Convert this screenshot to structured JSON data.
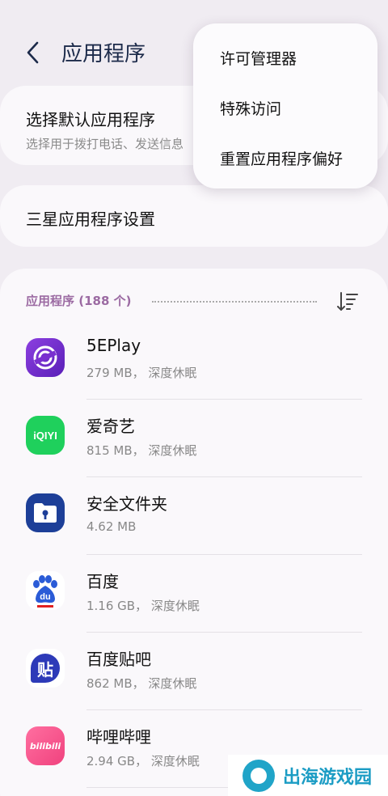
{
  "header": {
    "title": "应用程序"
  },
  "default_apps": {
    "title": "选择默认应用程序",
    "subtitle": "选择用于拨打电话、发送信息"
  },
  "samsung_settings": {
    "title": "三星应用程序设置"
  },
  "list": {
    "label": "应用程序 (188 个)",
    "apps": [
      {
        "name": "5EPlay",
        "meta": "279 MB， 深度休眠",
        "icon": "5eplay-app-icon"
      },
      {
        "name": "爱奇艺",
        "meta": "815 MB， 深度休眠",
        "icon": "iqiyi-app-icon",
        "icon_text": "iQIYI"
      },
      {
        "name": "安全文件夹",
        "meta": "4.62 MB",
        "icon": "secure-folder-app-icon"
      },
      {
        "name": "百度",
        "meta": "1.16 GB， 深度休眠",
        "icon": "baidu-app-icon",
        "icon_text": "du"
      },
      {
        "name": "百度贴吧",
        "meta": "862 MB， 深度休眠",
        "icon": "baidu-tieba-app-icon",
        "icon_text": "贴"
      },
      {
        "name": "哔哩哔哩",
        "meta": "2.94 GB， 深度休眠",
        "icon": "bilibili-app-icon",
        "icon_text": "bilibili"
      }
    ]
  },
  "menu": {
    "items": [
      "许可管理器",
      "特殊访问",
      "重置应用程序偏好"
    ]
  },
  "watermark": {
    "text": "出海游戏园"
  }
}
